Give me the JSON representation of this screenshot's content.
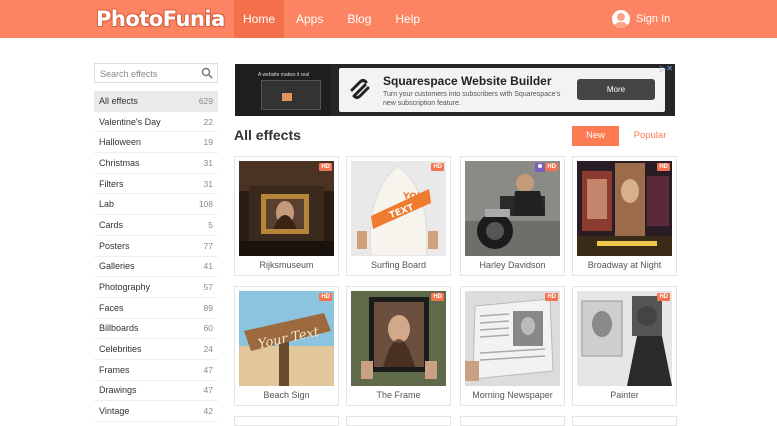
{
  "header": {
    "logo_photo": "Photo",
    "logo_funia": "Funia",
    "nav": [
      "Home",
      "Apps",
      "Blog",
      "Help"
    ],
    "signin": "Sign In"
  },
  "sidebar": {
    "search_placeholder": "Search effects",
    "categories": [
      {
        "label": "All effects",
        "count": "629"
      },
      {
        "label": "Valentine's Day",
        "count": "22"
      },
      {
        "label": "Halloween",
        "count": "19"
      },
      {
        "label": "Christmas",
        "count": "31"
      },
      {
        "label": "Filters",
        "count": "31"
      },
      {
        "label": "Lab",
        "count": "108"
      },
      {
        "label": "Cards",
        "count": "5"
      },
      {
        "label": "Posters",
        "count": "77"
      },
      {
        "label": "Galleries",
        "count": "41"
      },
      {
        "label": "Photography",
        "count": "57"
      },
      {
        "label": "Faces",
        "count": "89"
      },
      {
        "label": "Billboards",
        "count": "60"
      },
      {
        "label": "Celebrities",
        "count": "24"
      },
      {
        "label": "Frames",
        "count": "47"
      },
      {
        "label": "Drawings",
        "count": "47"
      },
      {
        "label": "Vintage",
        "count": "42"
      }
    ]
  },
  "ad": {
    "left_text": "A website makes it real",
    "title": "Squarespace Website Builder",
    "subtitle": "Turn your customers into subscribers with Squarespace's new subscription feature.",
    "button": "More"
  },
  "main": {
    "title": "All effects",
    "sort_new": "New",
    "sort_popular": "Popular",
    "hd_badge": "HD",
    "effects": [
      {
        "label": "Rijksmuseum"
      },
      {
        "label": "Surfing Board",
        "board_text": "YOUR TEXT"
      },
      {
        "label": "Harley Davidson"
      },
      {
        "label": "Broadway at Night"
      },
      {
        "label": "Beach Sign",
        "sign_text": "Your Text"
      },
      {
        "label": "The Frame"
      },
      {
        "label": "Morning Newspaper"
      },
      {
        "label": "Painter"
      }
    ]
  }
}
